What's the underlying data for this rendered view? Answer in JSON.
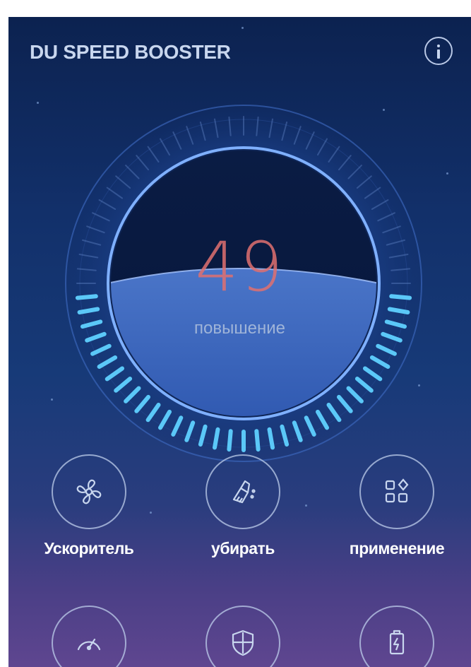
{
  "header": {
    "app_title": "DU SPEED BOOSTER",
    "info_icon": "info-icon"
  },
  "gauge": {
    "value": "49",
    "label": "повышение",
    "accent": "#5fd0ff",
    "value_color": "#e07070"
  },
  "features": [
    {
      "label": "Ускоритель",
      "icon": "fan-icon"
    },
    {
      "label": "убирать",
      "icon": "broom-icon"
    },
    {
      "label": "применение",
      "icon": "apps-grid-icon"
    },
    {
      "label": "",
      "icon": "speedometer-icon"
    },
    {
      "label": "",
      "icon": "shield-icon"
    },
    {
      "label": "",
      "icon": "battery-icon"
    }
  ]
}
